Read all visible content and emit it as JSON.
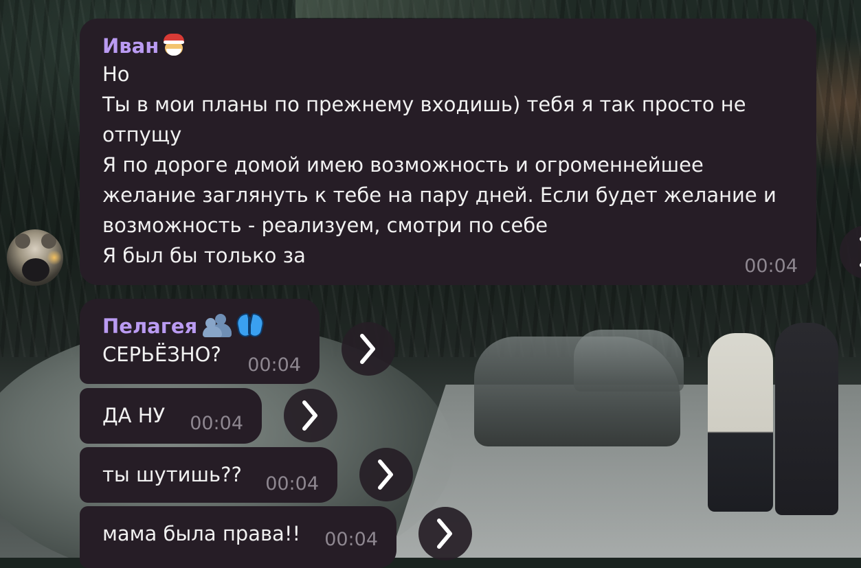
{
  "messages": [
    {
      "sender": "Иван",
      "sender_emoji": "santa-emoji",
      "lines": [
        "Но",
        "Ты в мои планы по прежнему входишь) тебя я так просто не",
        "отпущу",
        "Я по дороге домой имею возможность и огроменнейшее",
        "желание заглянуть к тебе на пару дней. Если будет желание и",
        "возможность - реализуем, смотри по себе",
        "Я был бы только за"
      ],
      "time": "00:04"
    },
    {
      "sender": "Пелагея",
      "sender_emoji": [
        "people-hugging-emoji",
        "butterfly-emoji"
      ],
      "text": "СЕРЬЁЗНО?",
      "time": "00:04"
    },
    {
      "text": "ДА НУ",
      "time": "00:04"
    },
    {
      "text": "ты шутишь??",
      "time": "00:04"
    },
    {
      "text": "мама была права!!",
      "time": "00:04"
    }
  ],
  "icons": {
    "forward": "chevron-right-icon",
    "avatar": "user-avatar"
  },
  "colors": {
    "bubble": "#261d26",
    "sender_ivan": "#ba9bf2",
    "text": "#f1f1f1",
    "time": "#8e8790"
  }
}
